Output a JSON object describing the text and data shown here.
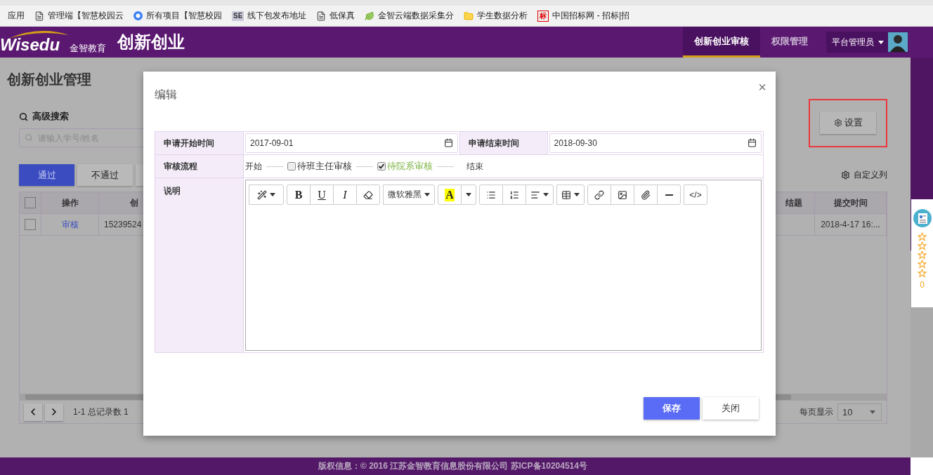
{
  "bookmarks": [
    {
      "label": "应用",
      "kind": "apps"
    },
    {
      "label": "管理端【智慧校园云",
      "kind": "page"
    },
    {
      "label": "所有项目【智慧校园",
      "kind": "c"
    },
    {
      "label": "线下包发布地址",
      "kind": "se",
      "badge": "SE"
    },
    {
      "label": "低保真",
      "kind": "page"
    },
    {
      "label": "金智云端数据采集分",
      "kind": "leaf"
    },
    {
      "label": "学生数据分析",
      "kind": "folder"
    },
    {
      "label": "中国招标网 - 招标|招",
      "kind": "mark",
      "badge": "标"
    }
  ],
  "header": {
    "logo_text": "Wisedu",
    "logo_subtext": "金智教育",
    "app_title": "创新创业",
    "nav": [
      {
        "label": "创新创业审核",
        "selected": true
      },
      {
        "label": "权限管理",
        "selected": false
      }
    ],
    "user": "平台管理员"
  },
  "page": {
    "title": "创新创业管理",
    "search_title": "高级搜索",
    "search": {
      "placeholder": "请输入学号/姓名"
    },
    "actions": [
      {
        "label": "通过",
        "kind": "primary"
      },
      {
        "label": "不通过",
        "kind": "default"
      },
      {
        "kind": "default"
      }
    ],
    "settings_button": "设置",
    "custom_columns": "自定义列",
    "table": {
      "all_checked": false,
      "columns_left": [
        "操作",
        "创"
      ],
      "columns_right": [
        "结题",
        "提交时间"
      ],
      "rows": [
        {
          "checked": false,
          "action": "审核",
          "column_2": "15239524",
          "submitted": "2018-4-17 16:..."
        }
      ]
    },
    "pager": {
      "summary": "1-1 总记录数 1",
      "per_page_label": "每页显示",
      "per_page": "10"
    }
  },
  "rating": {
    "count": "0"
  },
  "dialog": {
    "title": "编辑",
    "close": "×",
    "start_label": "申请开始时间",
    "start_value": "2017-09-01",
    "end_label": "申请结束时间",
    "end_value": "2018-09-30",
    "flow_label": "审核流程",
    "flow": [
      {
        "kind": "text",
        "label": "开始"
      },
      {
        "kind": "check",
        "label": "待班主任审核",
        "checked": false
      },
      {
        "kind": "check",
        "label": "待院系审核",
        "checked": true
      },
      {
        "kind": "text",
        "label": "结束"
      }
    ],
    "note_label": "说明",
    "toolbar": [
      [
        {
          "kind": "wand"
        }
      ],
      [
        {
          "kind": "bold",
          "label": "B"
        },
        {
          "kind": "underline",
          "label": "U"
        },
        {
          "kind": "italic",
          "label": "I"
        },
        {
          "kind": "eraser"
        }
      ],
      [
        {
          "kind": "font",
          "label": "微软雅黑"
        }
      ],
      [
        {
          "kind": "color",
          "label": "A"
        },
        {
          "kind": "dropdown"
        }
      ],
      [
        {
          "kind": "bullets"
        },
        {
          "kind": "numbers"
        },
        {
          "kind": "align"
        }
      ],
      [
        {
          "kind": "table"
        }
      ],
      [
        {
          "kind": "link"
        },
        {
          "kind": "image"
        },
        {
          "kind": "attach"
        },
        {
          "kind": "rule"
        }
      ],
      [
        {
          "kind": "code",
          "label": "</>"
        }
      ]
    ],
    "buttons": [
      {
        "label": "保存",
        "kind": "primary"
      },
      {
        "label": "关闭",
        "kind": "default"
      }
    ]
  },
  "footer": "版权信息：© 2016 江苏金智教育信息股份有限公司 苏ICP备10204514号"
}
